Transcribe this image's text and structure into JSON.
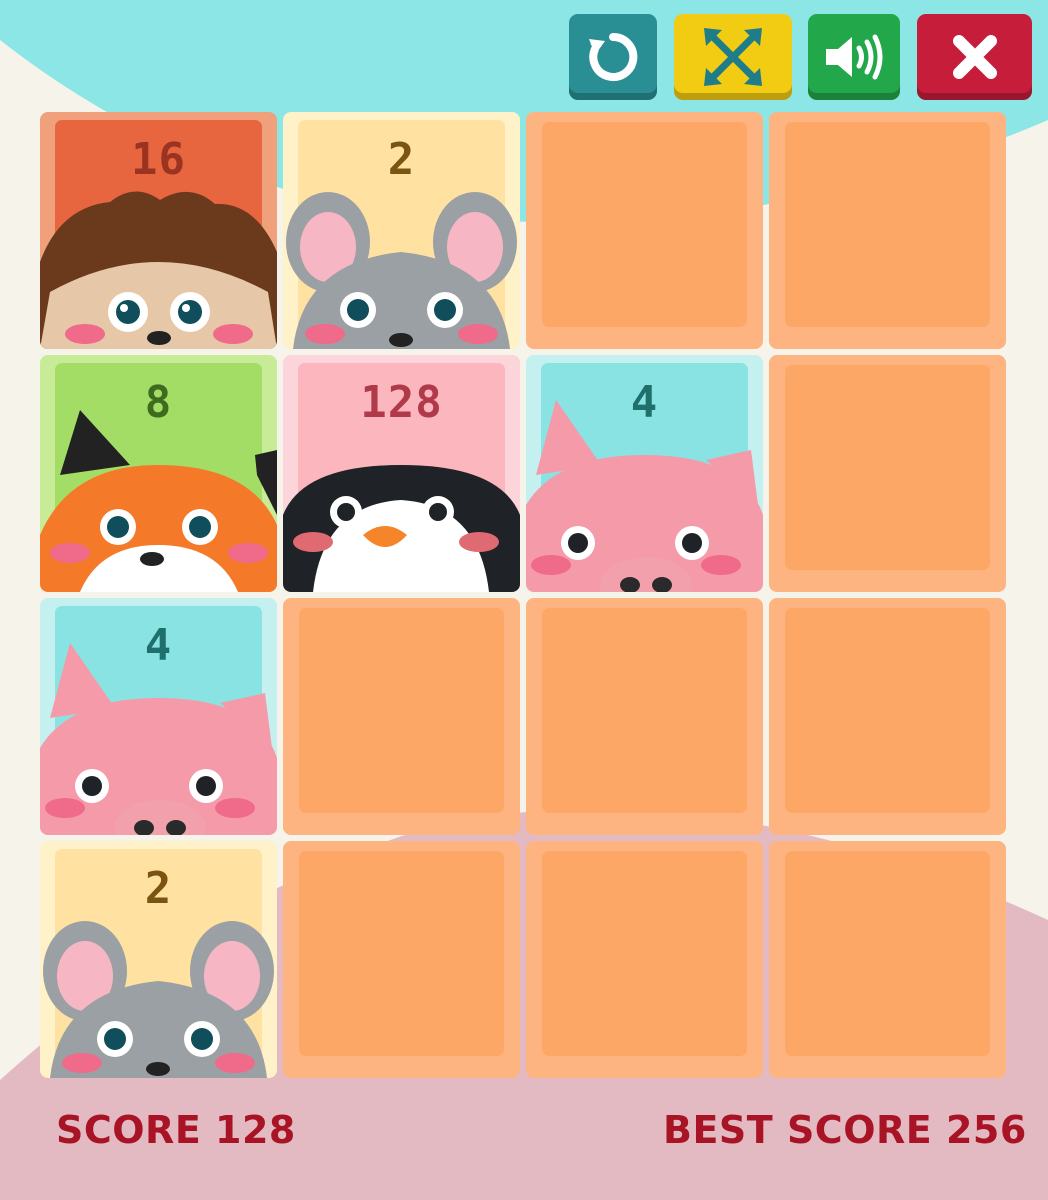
{
  "toolbar": {
    "restart": {
      "icon": "restart-icon",
      "color": "#2a8f94"
    },
    "fullscreen": {
      "icon": "fullscreen-arrows-icon",
      "color": "#f2cc12"
    },
    "sound": {
      "icon": "speaker-icon",
      "color": "#22a84a"
    },
    "close": {
      "icon": "close-x-icon",
      "color": "#c61d3a"
    }
  },
  "board": {
    "rows": [
      [
        {
          "value": "16",
          "animal": "hedgehog"
        },
        {
          "value": "2",
          "animal": "mouse"
        },
        {
          "value": "",
          "animal": ""
        },
        {
          "value": "",
          "animal": ""
        }
      ],
      [
        {
          "value": "8",
          "animal": "fox"
        },
        {
          "value": "128",
          "animal": "penguin"
        },
        {
          "value": "4",
          "animal": "pig"
        },
        {
          "value": "",
          "animal": ""
        }
      ],
      [
        {
          "value": "4",
          "animal": "pig"
        },
        {
          "value": "",
          "animal": ""
        },
        {
          "value": "",
          "animal": ""
        },
        {
          "value": "",
          "animal": ""
        }
      ],
      [
        {
          "value": "2",
          "animal": "mouse"
        },
        {
          "value": "",
          "animal": ""
        },
        {
          "value": "",
          "animal": ""
        },
        {
          "value": "",
          "animal": ""
        }
      ]
    ]
  },
  "tile_colors": {
    "16": {
      "bg": "#f0a17b",
      "face": "#e8663f",
      "num": "#9a3320"
    },
    "2": {
      "bg": "#fff1c8",
      "face": "#ffe2a2",
      "num": "#7a5512"
    },
    "8": {
      "bg": "#c8eb98",
      "face": "#a4dd66",
      "num": "#3f6b1f"
    },
    "128": {
      "bg": "#fbd5d9",
      "face": "#fbb6be",
      "num": "#b03a4a"
    },
    "4": {
      "bg": "#c4f0f0",
      "face": "#8ae3e3",
      "num": "#1f6f6c"
    }
  },
  "score": {
    "label": "SCORE 128"
  },
  "best_score": {
    "label": "BEST SCORE 256"
  }
}
